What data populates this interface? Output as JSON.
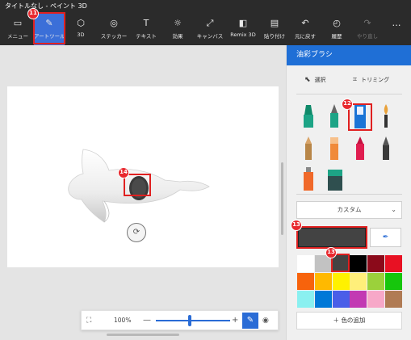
{
  "window": {
    "title": "タイトルなし - ペイント 3D"
  },
  "toolbar": {
    "items": [
      {
        "label": "メニュー",
        "icon": "folder-icon"
      },
      {
        "label": "アートツール",
        "icon": "brush-icon"
      },
      {
        "label": "3D",
        "icon": "cube-icon"
      },
      {
        "label": "ステッカー",
        "icon": "sticker-icon"
      },
      {
        "label": "テキスト",
        "icon": "text-icon"
      },
      {
        "label": "効果",
        "icon": "effects-icon"
      },
      {
        "label": "キャンバス",
        "icon": "canvas-icon"
      },
      {
        "label": "Remix 3D",
        "icon": "remix-icon"
      },
      {
        "label": "貼り付け",
        "icon": "paste-icon"
      },
      {
        "label": "元に戻す",
        "icon": "undo-icon"
      },
      {
        "label": "履歴",
        "icon": "history-icon"
      },
      {
        "label": "やり直し",
        "icon": "redo-icon"
      }
    ],
    "more": "…"
  },
  "annotations": {
    "b11": "11",
    "b12": "12",
    "b13a": "13",
    "b13b": "13",
    "b14": "14"
  },
  "panel": {
    "title": "油彩ブラシ",
    "select_label": "選択",
    "trim_label": "トリミング",
    "dropdown_value": "カスタム",
    "add_color_label": "色の追加",
    "selected_color": "#434343"
  },
  "palette": [
    "#ffffff",
    "#c2c2c2",
    "#434343",
    "#000000",
    "#8b0a1a",
    "#e81123",
    "#f7630c",
    "#ffb900",
    "#fff100",
    "#ffef7a",
    "#9bd13b",
    "#16c60c",
    "#8af0f0",
    "#0078d7",
    "#4a5ee8",
    "#c239b3",
    "#f7a8c8",
    "#b07b54"
  ],
  "zoom": {
    "value": "100%",
    "minus": "—",
    "plus": "+",
    "level": 0.45
  }
}
